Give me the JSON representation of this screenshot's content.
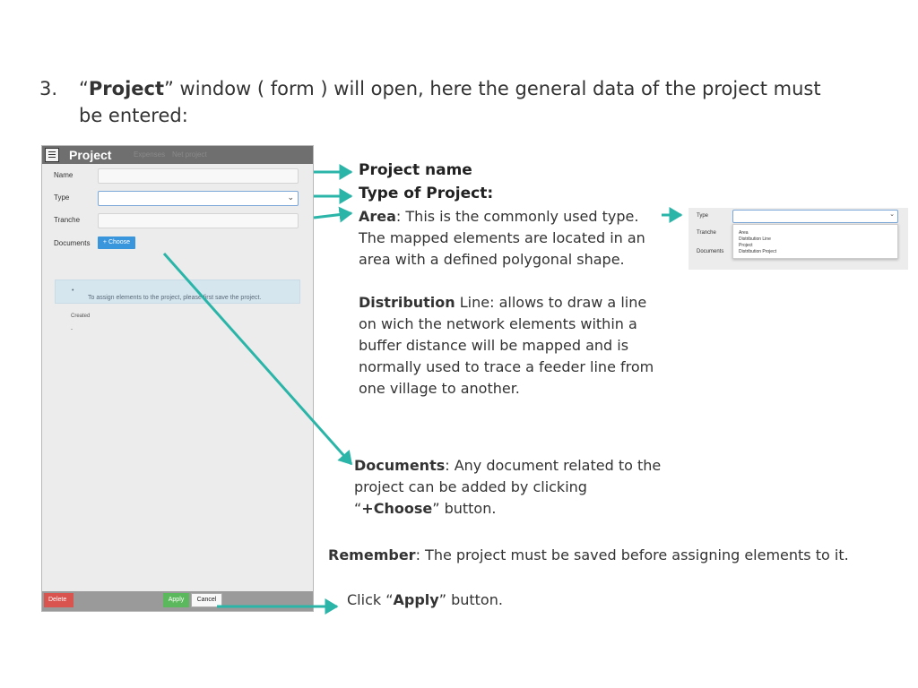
{
  "heading": {
    "number": "3.",
    "open_quote": "“",
    "bold": "Project",
    "rest": "” window ( form ) will open, here the general data of the project must be entered:"
  },
  "form": {
    "title": "Project",
    "tabs": [
      "Expenses",
      "Net project"
    ],
    "fields": {
      "name_label": "Name",
      "type_label": "Type",
      "tranche_label": "Tranche",
      "documents_label": "Documents"
    },
    "choose_button": "+ Choose",
    "info_text": "To assign elements to the project, please first save the project.",
    "created_label": "Created",
    "created_value": "-",
    "delete_button": "Delete",
    "apply_button": "Apply",
    "cancel_button": "Cancel"
  },
  "annotations": {
    "project_name": "Project name",
    "type_of_project": "Type of Project:",
    "area_bold": "Area",
    "area_text": ": This is the commonly used type. The mapped elements are located in an area with a defined polygonal shape.",
    "distribution_bold": "Distribution",
    "distribution_text": " Line: allows to draw a line on wich the network elements within a buffer distance will be mapped and is normally used to trace a feeder line from one village to another.",
    "documents_bold": "Documents",
    "documents_text_1": ":  Any document related to the project can be added by clicking ",
    "documents_quote_open": "“",
    "documents_choose": "+Choose",
    "documents_text_2": "” button.",
    "remember_bold": "Remember",
    "remember_text": ": The project must be saved before assigning elements to it.",
    "click_text": "Click “",
    "click_bold": "Apply",
    "click_end": "” button."
  },
  "type_dropdown": {
    "type_label": "Type",
    "tranche_label": "Tranche",
    "documents_label": "Documents",
    "options": [
      "Area",
      "Distribution Line",
      "Project",
      "Distribution Project"
    ]
  },
  "colors": {
    "arrow": "#2bb5a8",
    "choose_button": "#3a96dc",
    "delete_button": "#d9534f",
    "apply_button": "#5cb85c"
  }
}
